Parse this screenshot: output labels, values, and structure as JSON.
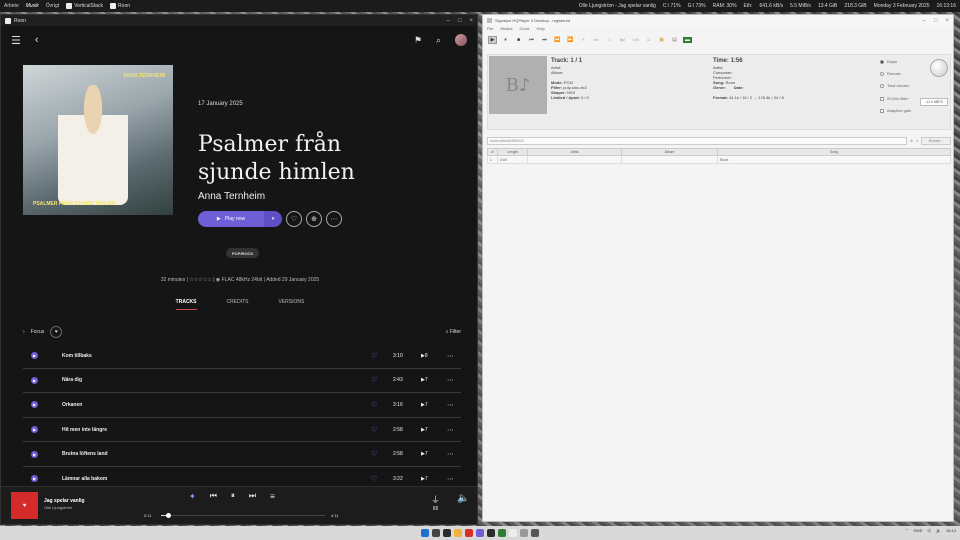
{
  "topbar": {
    "workspaces": [
      "Arbete",
      "Musik",
      "Övrigt"
    ],
    "active_workspace": "Musik",
    "apps": [
      "VerticalStack",
      "Roon"
    ],
    "now_playing": "Olle Ljungström - Jag spelar vanlig",
    "stats": [
      "C:\\ 71%",
      "G:\\ 73%",
      "RAM: 30%",
      "Eth:",
      "641.6 kB/s",
      "5.5 MiB/s",
      "13.4 GiB",
      "218.3 GiB",
      "Monday 3 February 2025",
      "16:13:16"
    ]
  },
  "roon": {
    "window_title": "Roon",
    "album": {
      "release_date": "17 January 2025",
      "title_line1": "Psalmer från",
      "title_line2": "sjunde himlen",
      "artist": "Anna Ternheim",
      "art_artist": "ANNA TERNHEIM",
      "art_title": "PSALMER FRÅN SJUNDE HIMLEN",
      "play_label": "Play now",
      "genre": "POP/ROCK",
      "duration": "32 minutes",
      "rating": "☆☆☆☆☆",
      "format": "FLAC 48kHz 24bit",
      "added": "Added 29 January 2025"
    },
    "tabs": [
      "TRACKS",
      "CREDITS",
      "VERSIONS"
    ],
    "focus_label": "Focus",
    "filter_label": "Filter",
    "tracks": [
      {
        "name": "Kom tillbaks",
        "length": "3:10",
        "plays": "8"
      },
      {
        "name": "Nära dig",
        "length": "2:43",
        "plays": "7"
      },
      {
        "name": "Orkanen",
        "length": "3:16",
        "plays": "7"
      },
      {
        "name": "Hit men inte längre",
        "length": "2:58",
        "plays": "7"
      },
      {
        "name": "Brutna löftens land",
        "length": "2:58",
        "plays": "7"
      },
      {
        "name": "Lämnar alla bakom",
        "length": "3:22",
        "plays": "7"
      }
    ],
    "nowplaying": {
      "title": "Jag spelar vanlig",
      "artist": "Olle Ljungström",
      "elapsed": "0:11",
      "total": "4:11",
      "progress": 0.044,
      "volume": "88"
    }
  },
  "hqp": {
    "window_title": "Signalyst HQPlayer 4 Desktop - registered",
    "menu": [
      "File",
      "Modes",
      "Clock",
      "Help"
    ],
    "toolbar_labels": [
      "Inv",
      "1",
      "Bpl",
      "Cn3"
    ],
    "track_label": "Track:",
    "track_value": "1 / 1",
    "artist_label": "Artist:",
    "album_label": "Album:",
    "mode_label": "Mode:",
    "mode_value": "PCM",
    "filter_label": "Filter:",
    "filter_value": "poly-sinc-xtr2",
    "shaper_label": "Shaper:",
    "shaper_value": "NS9",
    "limited_label": "Limited / Apod:",
    "limited_value": "0 / 0",
    "time_label": "Time:",
    "time_value": "1:56",
    "artist2_label": "Artist:",
    "composer_label": "Composer:",
    "performer_label": "Performer:",
    "song_label": "Song:",
    "song_value": "Roon",
    "genre_label": "Genre:",
    "date_label": "Date:",
    "format_label": "Format:",
    "format_value": "44.1k / 16 / 2 → 176.4k / 24 / 8",
    "options": [
      "Elaps",
      "Remain",
      "Total remain",
      "20 kHz filter",
      "Adaptive gain"
    ],
    "volume": "-12.0 dBFS",
    "path": "audio:default/48000/2",
    "browse": "Browse...",
    "columns": [
      "#",
      "Length",
      "Artist",
      "Album",
      "Song"
    ],
    "row": {
      "num": "1",
      "length": "0:00",
      "artist": "",
      "album": "",
      "song": "Roon"
    }
  },
  "taskbar": {
    "tray_lang": "SWE",
    "tray_time": "16:13"
  }
}
